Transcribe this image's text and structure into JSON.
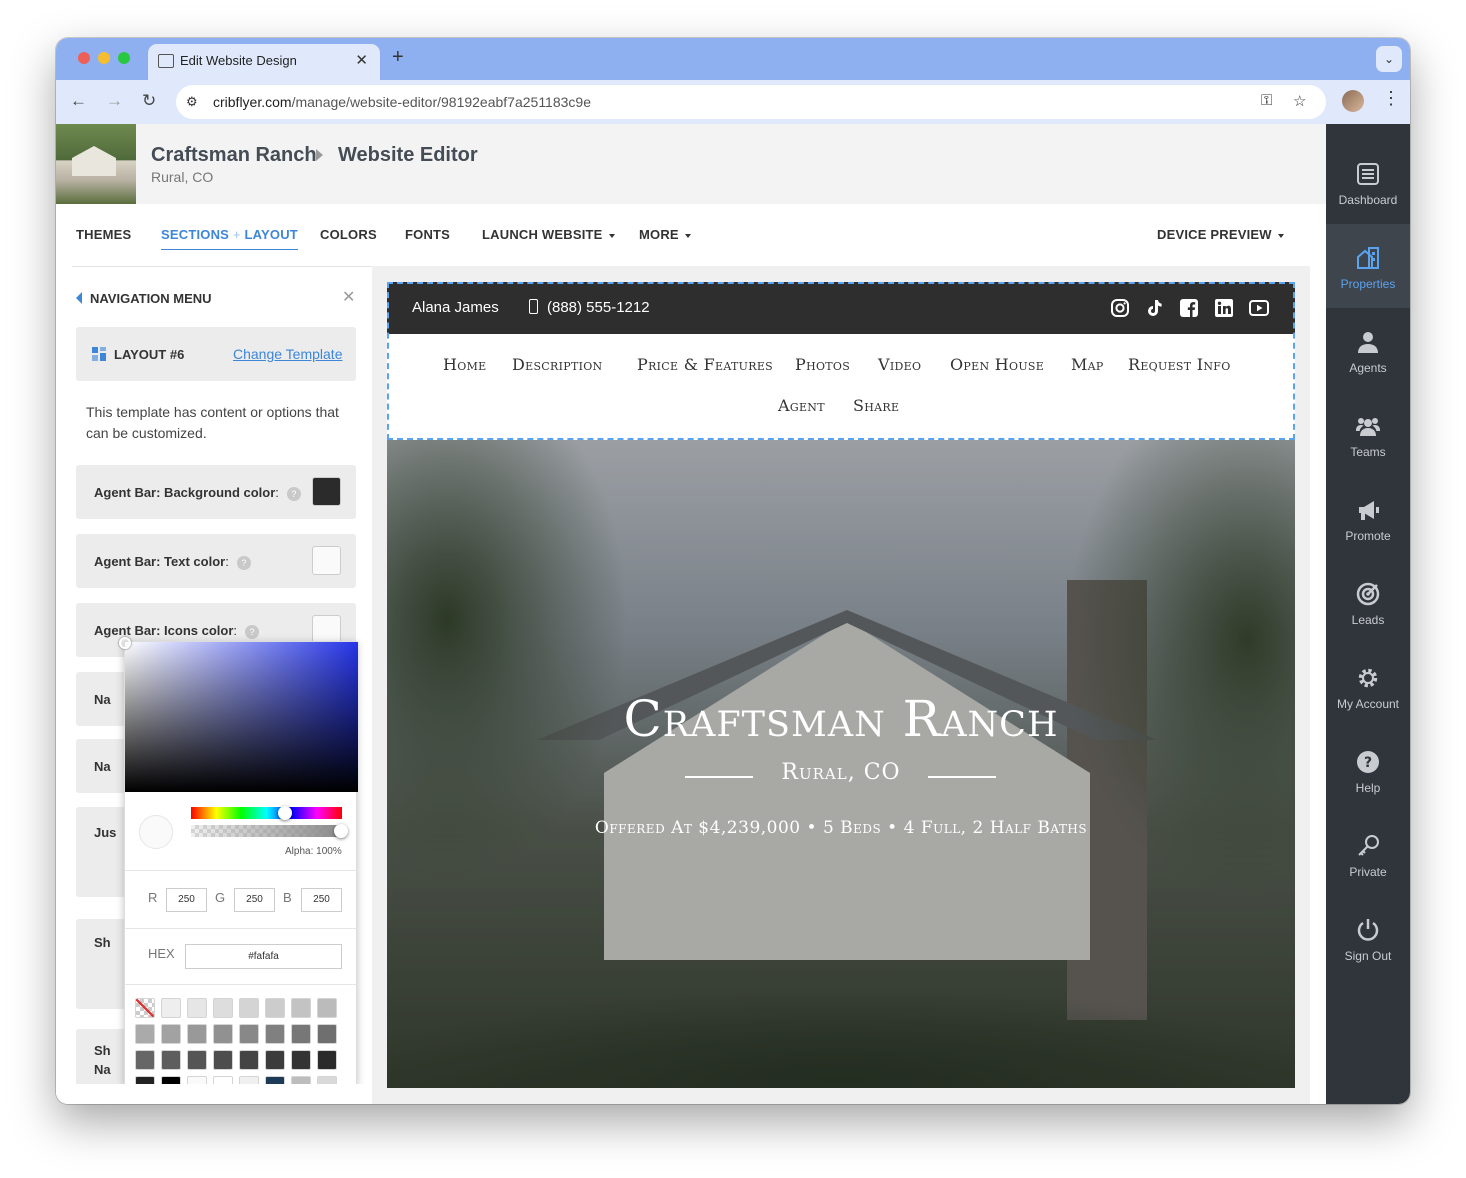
{
  "browser": {
    "tab_title": "Edit Website Design",
    "url_domain": "cribflyer.com",
    "url_path": "/manage/website-editor/98192eabf7a251183c9e"
  },
  "header": {
    "property_name": "Craftsman Ranch",
    "editor_title": "Website Editor",
    "location": "Rural, CO"
  },
  "menu": {
    "themes": "THEMES",
    "sections_a": "SECTIONS",
    "sections_plus": " + ",
    "sections_b": "LAYOUT",
    "colors": "COLORS",
    "fonts": "FONTS",
    "launch": "LAUNCH WEBSITE",
    "more": "MORE",
    "device": "DEVICE PREVIEW"
  },
  "panel": {
    "title": "NAVIGATION MENU",
    "layout_label": "LAYOUT #6",
    "change_template": "Change Template",
    "description": "This template has content or options that can be customized.",
    "options": [
      {
        "label": "Agent Bar: Background color",
        "suffix": ":",
        "swatch": "#2b2b2b"
      },
      {
        "label": "Agent Bar: Text color",
        "suffix": ":",
        "swatch": "#fafafa"
      },
      {
        "label": "Agent Bar: Icons color",
        "suffix": ":",
        "swatch": "#fafafa"
      }
    ],
    "truncated": [
      "Na",
      "Na",
      "Jus",
      "Sh",
      "Sh",
      "Na"
    ]
  },
  "picker": {
    "alpha_label": "Alpha: 100%",
    "r_label": "R",
    "r": "250",
    "g_label": "G",
    "g": "250",
    "b_label": "B",
    "b": "250",
    "hex_label": "HEX",
    "hex": "#fafafa",
    "palette_row1": [
      "#eeeeee",
      "#e6e6e6",
      "#dddddd",
      "#d4d4d4",
      "#cccccc",
      "#c3c3c3",
      "#bbbbbb"
    ],
    "palette_row2": [
      "#aaaaaa",
      "#a2a2a2",
      "#999999",
      "#919191",
      "#888888",
      "#808080",
      "#777777",
      "#6f6f6f"
    ],
    "palette_row3": [
      "#666666",
      "#5e5e5e",
      "#555555",
      "#4d4d4d",
      "#444444",
      "#3c3c3c",
      "#333333",
      "#2b2b2b"
    ],
    "palette_row4": [
      "#222222",
      "#000000",
      "#fafafa",
      "#ffffff",
      "#f0f0f0",
      "#1d3a56",
      "#bdbdbd",
      "#d9d9d9"
    ]
  },
  "site": {
    "agent_name": "Alana James",
    "agent_phone": "(888) 555-1212",
    "nav_row1": [
      "Home",
      "Description",
      "Price & Features",
      "Photos",
      "Video",
      "Open House",
      "Map",
      "Request Info"
    ],
    "nav_row2": [
      "Agent",
      "Share"
    ],
    "hero_title": "Craftsman Ranch",
    "hero_subtitle": "Rural, CO",
    "hero_details": "Offered At $4,239,000 • 5 Beds • 4 Full, 2 Half Baths"
  },
  "sidebar": {
    "items": [
      "Dashboard",
      "Properties",
      "Agents",
      "Teams",
      "Promote",
      "Leads",
      "My Account",
      "Help",
      "Private",
      "Sign Out"
    ],
    "active": "Properties"
  },
  "colors": {
    "accent": "#3d86d8",
    "sidebar_bg": "#30353b",
    "agent_bar_bg": "#2e2e2e"
  }
}
